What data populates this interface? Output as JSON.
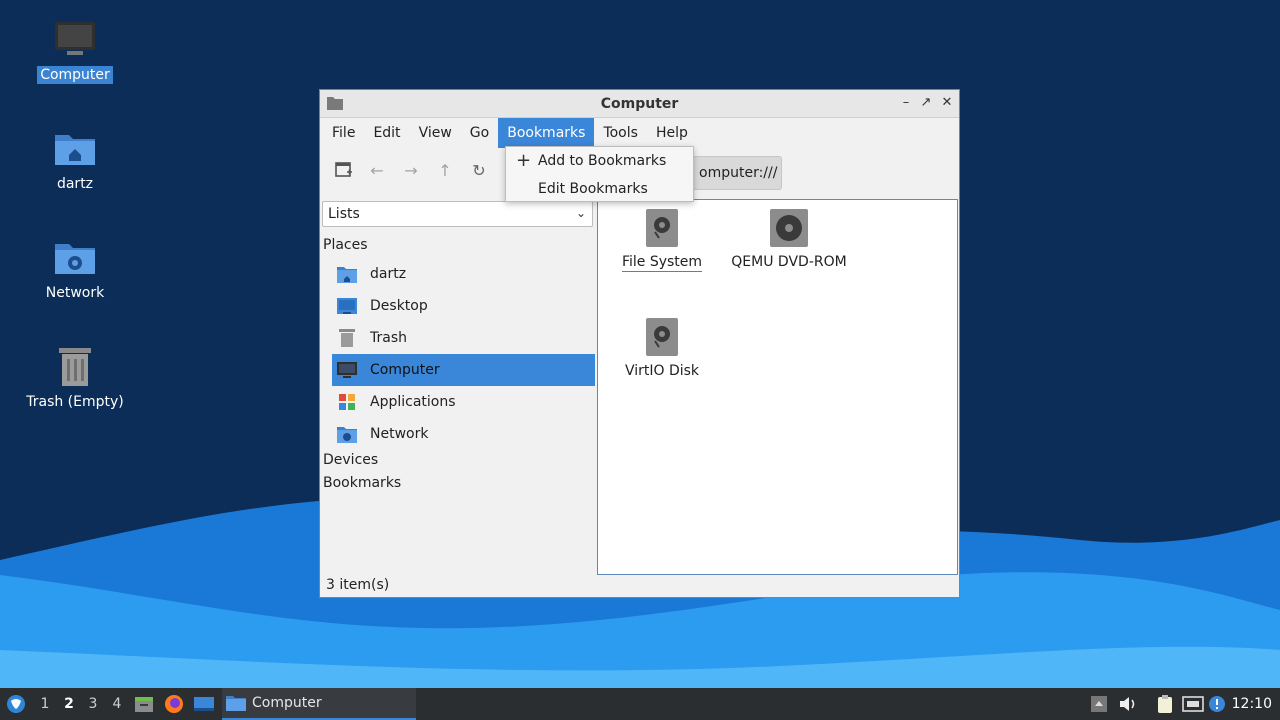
{
  "desktop": {
    "icons": [
      {
        "label": "Computer",
        "icon": "computer-icon",
        "selected": true
      },
      {
        "label": "dartz",
        "icon": "home-folder-icon"
      },
      {
        "label": "Network",
        "icon": "network-folder-icon"
      },
      {
        "label": "Trash (Empty)",
        "icon": "trash-icon"
      }
    ]
  },
  "window": {
    "title": "Computer",
    "controls": {
      "minimize": "minimize-icon",
      "maximize": "maximize-icon",
      "close": "close-icon"
    },
    "menubar": [
      "File",
      "Edit",
      "View",
      "Go",
      "Bookmarks",
      "Tools",
      "Help"
    ],
    "active_menu": "Bookmarks",
    "toolbar": {
      "buttons": [
        "new-tab-icon",
        "back-arrow-icon",
        "forward-arrow-icon",
        "up-arrow-icon",
        "reload-icon"
      ],
      "location_text": "omputer:///"
    },
    "bookmarks_menu": {
      "items": [
        {
          "label": "Add to Bookmarks",
          "icon": "plus-icon"
        },
        {
          "label": "Edit Bookmarks"
        }
      ]
    },
    "sidepane": {
      "view_select": "Lists",
      "places_header": "Places",
      "places": [
        {
          "label": "dartz",
          "icon": "home-folder-icon"
        },
        {
          "label": "Desktop",
          "icon": "desktop-icon"
        },
        {
          "label": "Trash",
          "icon": "trash-icon"
        },
        {
          "label": "Computer",
          "icon": "computer-icon",
          "active": true
        },
        {
          "label": "Applications",
          "icon": "applications-icon"
        },
        {
          "label": "Network",
          "icon": "network-folder-icon"
        }
      ],
      "devices_header": "Devices",
      "bookmarks_header": "Bookmarks"
    },
    "items": [
      {
        "label": "File System",
        "icon": "drive-harddisk-icon"
      },
      {
        "label": "QEMU DVD-ROM",
        "icon": "optical-drive-icon"
      },
      {
        "label": "VirtIO Disk",
        "icon": "drive-harddisk-icon"
      }
    ],
    "status": "3 item(s)"
  },
  "taskbar": {
    "workspaces": [
      "1",
      "2",
      "3",
      "4"
    ],
    "current_workspace": "2",
    "task_label": "Computer",
    "clock": "12:10"
  },
  "colors": {
    "accent": "#3a86d8",
    "desktop_bg": "#0b2d57",
    "taskbar_bg": "#2b2e31"
  }
}
